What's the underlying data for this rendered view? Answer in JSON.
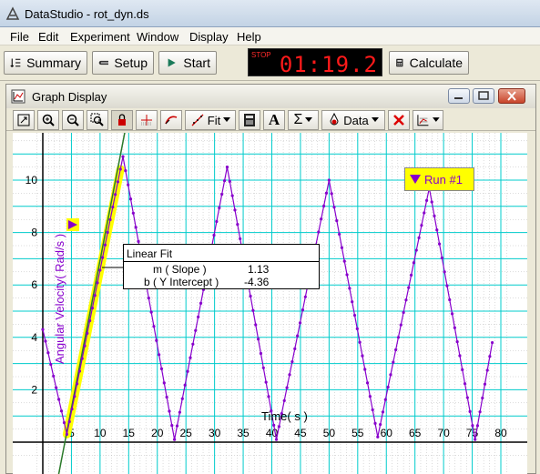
{
  "window": {
    "title": "DataStudio - rot_dyn.ds"
  },
  "menu": [
    "File",
    "Edit",
    "Experiment",
    "Window",
    "Display",
    "Help"
  ],
  "toolbar": {
    "summary": "Summary",
    "setup": "Setup",
    "start": "Start",
    "calculate": "Calculate",
    "stop_label": "STOP",
    "time": "01:19.2"
  },
  "graph_window": {
    "title": "Graph Display",
    "fit_label": "Fit",
    "data_label": "Data",
    "sigma": "Σ",
    "text_tool": "A"
  },
  "colors": {
    "series": "#8800cc",
    "fit": "#2a7a2a",
    "highlight": "#ffff00",
    "grid": "#00cccc",
    "minor_grid": "#b8b8b8"
  },
  "fit_box": {
    "title": "Linear Fit",
    "rows": [
      {
        "name": "m ( Slope )",
        "value": "1.13"
      },
      {
        "name": "b ( Y Intercept )",
        "value": "-4.36"
      }
    ]
  },
  "chart_data": {
    "type": "line",
    "xlabel": "Time( s )",
    "ylabel": "Angular Velocity( Rad/s )",
    "xlim": [
      -1,
      81
    ],
    "ylim": [
      -0.4,
      11.4
    ],
    "xticks": [
      5,
      10,
      15,
      20,
      25,
      30,
      35,
      40,
      45,
      50,
      55,
      60,
      65,
      70,
      75,
      80
    ],
    "yticks": [
      2,
      4,
      6,
      8,
      10
    ],
    "grid": true,
    "series": [
      {
        "name": "Run #1",
        "peaks": [
          [
            0,
            4.3
          ],
          [
            4.2,
            0.3
          ],
          [
            14.0,
            10.9
          ],
          [
            23.0,
            0.1
          ],
          [
            32.2,
            10.5
          ],
          [
            40.8,
            0.1
          ],
          [
            50.0,
            10.0
          ],
          [
            58.5,
            0.2
          ],
          [
            67.5,
            9.7
          ],
          [
            75.5,
            0.1
          ],
          [
            78.5,
            3.8
          ]
        ]
      }
    ],
    "fit": {
      "type": "linear",
      "slope": 1.13,
      "intercept": -4.36,
      "x_range": [
        4.5,
        13.5
      ]
    },
    "legend": "top-right"
  }
}
